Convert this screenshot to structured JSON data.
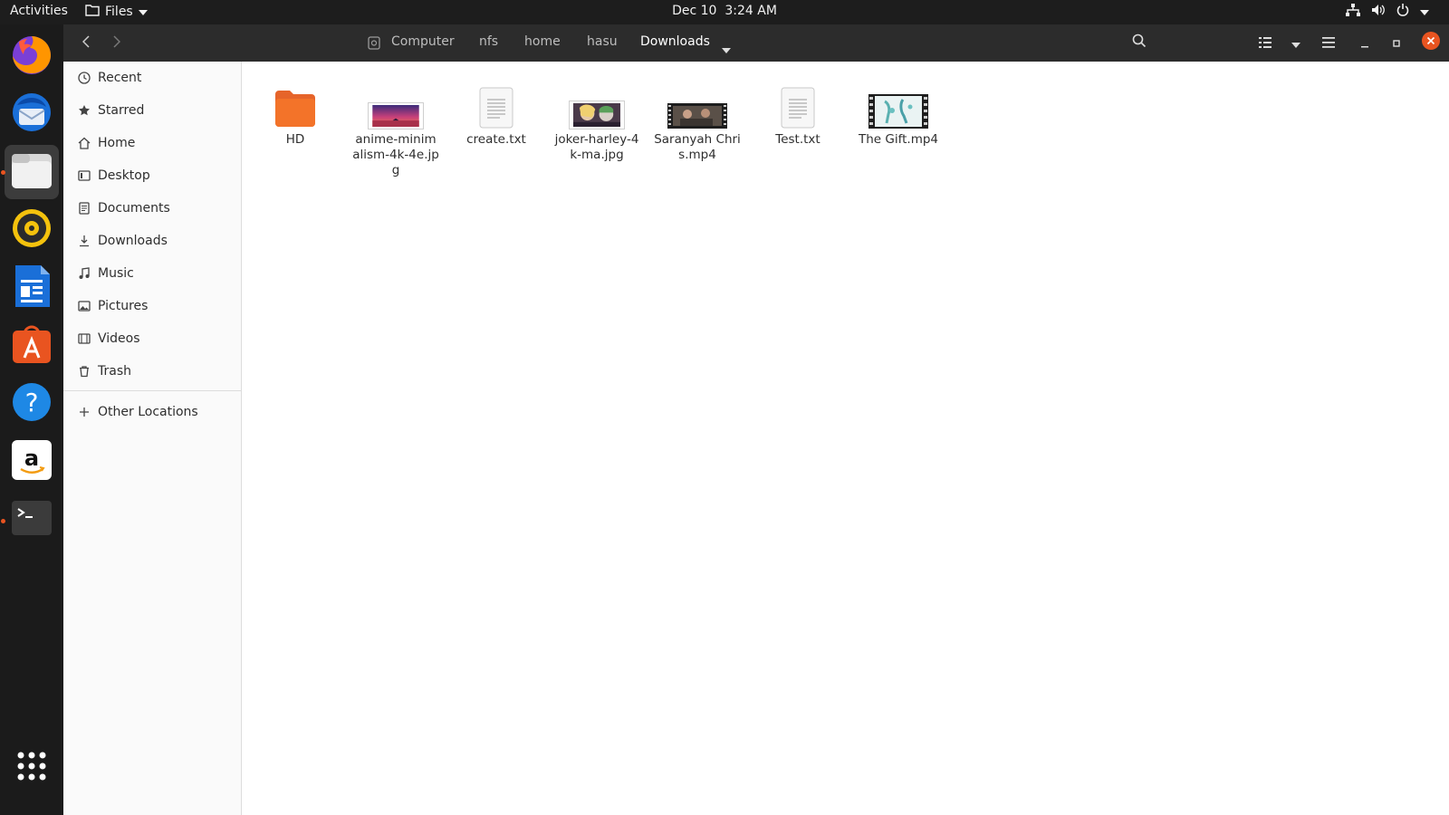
{
  "topbar": {
    "activities": "Activities",
    "app_name": "Files",
    "date": "Dec 10",
    "time": "3:24 AM"
  },
  "dock": {
    "apps": [
      "firefox",
      "thunderbird",
      "files",
      "rhythmbox",
      "writer",
      "app-center",
      "help",
      "amazon",
      "terminal",
      "show-apps"
    ]
  },
  "headerbar": {
    "breadcrumbs": [
      "Computer",
      "nfs",
      "home",
      "hasu",
      "Downloads"
    ]
  },
  "sidebar": {
    "items": [
      {
        "label": "Recent",
        "icon": "clock-icon"
      },
      {
        "label": "Starred",
        "icon": "star-icon"
      },
      {
        "label": "Home",
        "icon": "home-icon"
      },
      {
        "label": "Desktop",
        "icon": "desktop-icon"
      },
      {
        "label": "Documents",
        "icon": "document-icon"
      },
      {
        "label": "Downloads",
        "icon": "download-icon"
      },
      {
        "label": "Music",
        "icon": "music-icon"
      },
      {
        "label": "Pictures",
        "icon": "picture-icon"
      },
      {
        "label": "Videos",
        "icon": "video-icon"
      },
      {
        "label": "Trash",
        "icon": "trash-icon"
      }
    ],
    "other_locations": "Other Locations"
  },
  "files": [
    {
      "name": "HD",
      "kind": "folder"
    },
    {
      "name": "anime-minimalism-4k-4e.jpg",
      "kind": "image"
    },
    {
      "name": "create.txt",
      "kind": "text"
    },
    {
      "name": "joker-harley-4k-ma.jpg",
      "kind": "image"
    },
    {
      "name": "Saranyah Chris.mp4",
      "kind": "video"
    },
    {
      "name": "Test.txt",
      "kind": "text"
    },
    {
      "name": "The Gift.mp4",
      "kind": "video"
    }
  ],
  "colors": {
    "accent": "#e95420",
    "folder": "#f37329"
  }
}
